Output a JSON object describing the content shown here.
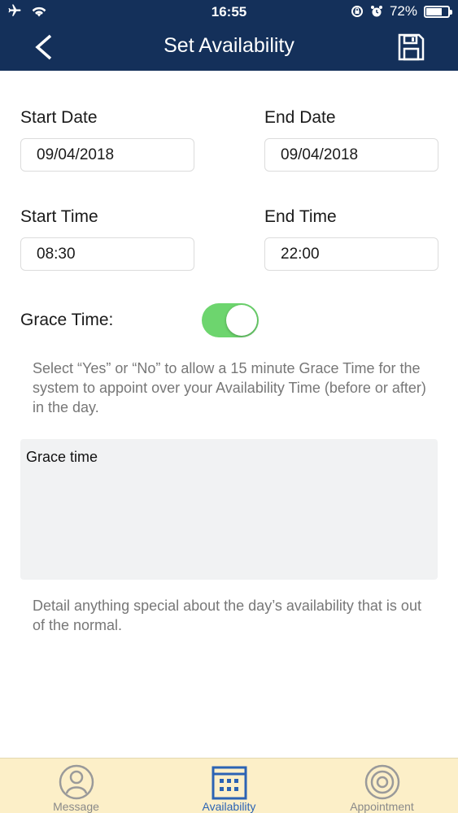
{
  "status": {
    "time": "16:55",
    "battery": "72%",
    "battery_level": 0.72
  },
  "nav": {
    "title": "Set Availability"
  },
  "form": {
    "start_date_label": "Start Date",
    "start_date_value": "09/04/2018",
    "end_date_label": "End Date",
    "end_date_value": "09/04/2018",
    "start_time_label": "Start Time",
    "start_time_value": "08:30",
    "end_time_label": "End Time",
    "end_time_value": "22:00",
    "grace_label": "Grace Time:",
    "grace_enabled": true,
    "grace_hint": "Select “Yes” or “No” to allow a 15 minute Grace Time for the system to appoint over your Availability Time (before or after) in the day.",
    "notes_value": "Grace time",
    "notes_hint": "Detail anything special about the day’s availability that is out of the normal."
  },
  "tabs": [
    {
      "label": "Message",
      "icon": "person-icon",
      "active": false
    },
    {
      "label": "Availability",
      "icon": "calendar-icon",
      "active": true
    },
    {
      "label": "Appointment",
      "icon": "target-icon",
      "active": false
    }
  ],
  "colors": {
    "header": "#14305a",
    "toggle_on": "#6dd56e",
    "tabbar": "#fcefc8",
    "active_tab": "#2b63b4"
  }
}
